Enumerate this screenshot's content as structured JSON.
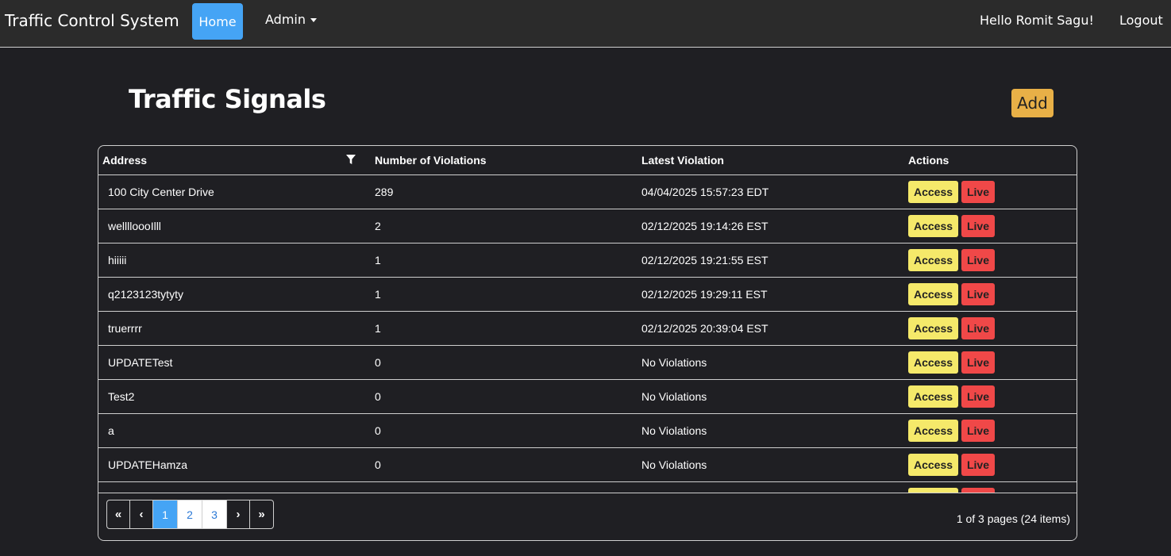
{
  "navbar": {
    "brand": "Traffic Control System",
    "home_label": "Home",
    "admin_label": "Admin",
    "greeting": "Hello Romit Sagu!",
    "logout_label": "Logout"
  },
  "page": {
    "title": "Traffic Signals",
    "add_label": "Add"
  },
  "grid": {
    "columns": [
      "Address",
      "Number of Violations",
      "Latest Violation",
      "Actions"
    ],
    "access_label": "Access",
    "live_label": "Live",
    "rows": [
      {
        "address": "100 City Center Drive",
        "violations": "289",
        "latest": "04/04/2025 15:57:23 EDT"
      },
      {
        "address": "welllloooIlll",
        "violations": "2",
        "latest": "02/12/2025 19:14:26 EST"
      },
      {
        "address": "hiiiii",
        "violations": "1",
        "latest": "02/12/2025 19:21:55 EST"
      },
      {
        "address": "q2123123tytyty",
        "violations": "1",
        "latest": "02/12/2025 19:29:11 EST"
      },
      {
        "address": "truerrrr",
        "violations": "1",
        "latest": "02/12/2025 20:39:04 EST"
      },
      {
        "address": "UPDATETest",
        "violations": "0",
        "latest": "No Violations"
      },
      {
        "address": "Test2",
        "violations": "0",
        "latest": "No Violations"
      },
      {
        "address": "a",
        "violations": "0",
        "latest": "No Violations"
      },
      {
        "address": "UPDATEHamza",
        "violations": "0",
        "latest": "No Violations"
      },
      {
        "address": "",
        "violations": "",
        "latest": ""
      }
    ]
  },
  "pager": {
    "first": "«",
    "prev": "‹",
    "pages": [
      "1",
      "2",
      "3"
    ],
    "current_page": "1",
    "next": "›",
    "last": "»",
    "info": "1 of 3 pages (24 items)"
  },
  "colors": {
    "background": "#1f1f23",
    "navbar": "#2b2b2b",
    "primary": "#45a4f5",
    "add": "#e8b047",
    "access": "#f5e96a",
    "live": "#f04848"
  }
}
